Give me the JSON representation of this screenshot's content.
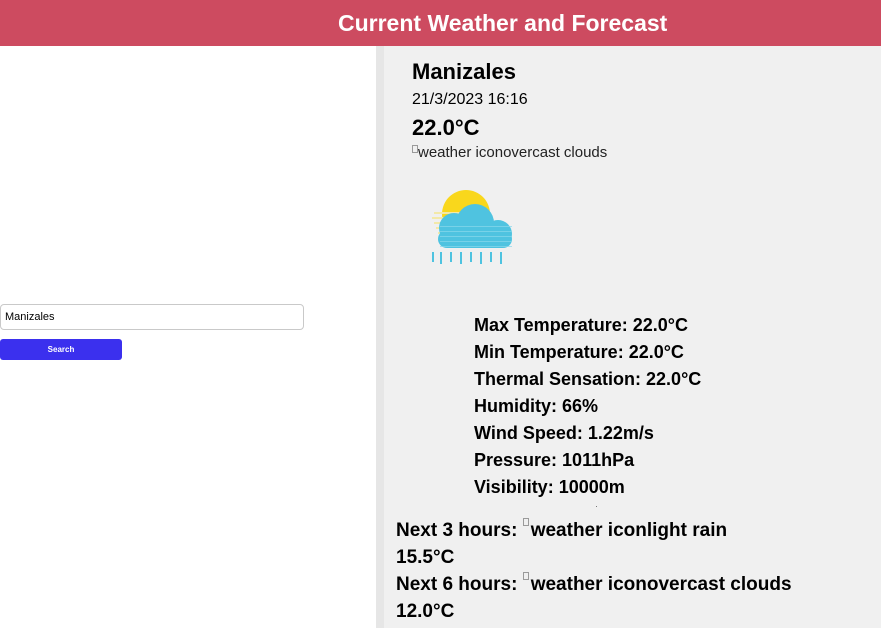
{
  "header": {
    "title": "Current Weather and Forecast"
  },
  "search": {
    "value": "Manizales",
    "button_label": "Search"
  },
  "current": {
    "city": "Manizales",
    "datetime": "21/3/2023 16:16",
    "temperature": "22.0°C",
    "icon_alt": "weather icon",
    "description": "overcast clouds",
    "icon_name": "sun-cloud-rain-icon"
  },
  "details": {
    "max_temp": "Max Temperature: 22.0°C",
    "min_temp": "Min Temperature: 22.0°C",
    "thermal": "Thermal Sensation: 22.0°C",
    "humidity": "Humidity: 66%",
    "wind": "Wind Speed: 1.22m/s",
    "pressure": "Pressure: 1011hPa",
    "visibility": "Visibility: 10000m"
  },
  "forecast": [
    {
      "label": "Next 3 hours:",
      "icon_alt": "weather icon",
      "description": "light rain",
      "temperature": "15.5°C"
    },
    {
      "label": "Next 6 hours:",
      "icon_alt": "weather icon",
      "description": "overcast clouds",
      "temperature": "12.0°C"
    }
  ],
  "colors": {
    "header": "#cd4b60",
    "button": "#3b30ee",
    "panel": "#f0f0f0",
    "sun": "#f9d71c",
    "cloud": "#4fc3e0"
  }
}
